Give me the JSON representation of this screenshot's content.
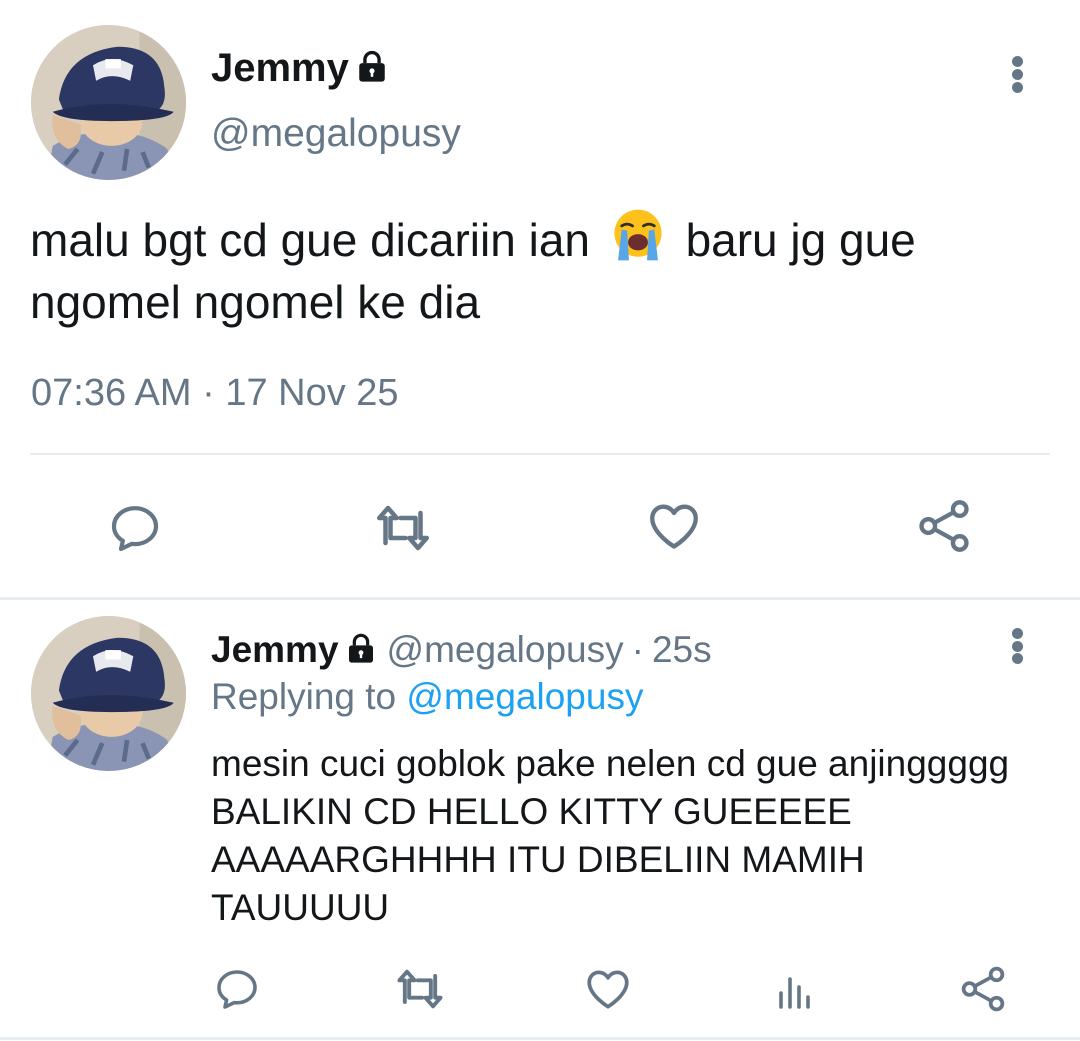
{
  "tweet": {
    "author_name": "Jemmy",
    "author_handle": "@megalopusy",
    "text_before_emoji": "malu bgt cd gue dicariin ian",
    "emoji": "loudly-crying-face",
    "text_after_emoji": "baru jg gue ngomel ngomel ke dia",
    "time": "07:36 AM",
    "date_separator": "·",
    "date": "17 Nov 25",
    "protected_icon": "lock-icon",
    "actions": [
      "reply-icon",
      "retweet-icon",
      "like-icon",
      "share-icon"
    ]
  },
  "reply": {
    "author_name": "Jemmy",
    "author_handle": "@megalopusy",
    "time_separator": "·",
    "time_ago": "25s",
    "replying_to_label": "Replying to",
    "replying_to_handle": "@megalopusy",
    "text": "mesin cuci goblok pake nelen cd gue anjinggggg BALIKIN CD HELLO KITTY GUEEEEE AAAAARGHHHH ITU DIBELIIN MAMIH TAUUUUU",
    "protected_icon": "lock-icon",
    "actions": [
      "reply-icon",
      "retweet-icon",
      "like-icon",
      "analytics-icon",
      "share-icon"
    ]
  },
  "colors": {
    "text": "#14171a",
    "secondary": "#657786",
    "link": "#1da1f2",
    "divider": "#e6ecf0"
  }
}
